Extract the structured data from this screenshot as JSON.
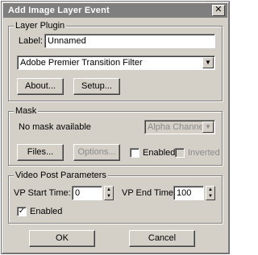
{
  "window": {
    "title": "Add Image Layer Event",
    "close_glyph": "✕"
  },
  "layer_plugin": {
    "group_label": "Layer Plugin",
    "label_caption": "Label:",
    "label_value": "Unnamed",
    "filter_selected": "Adobe Premier Transition Filter",
    "about_label": "About...",
    "setup_label": "Setup..."
  },
  "mask": {
    "group_label": "Mask",
    "no_mask_text": "No mask available",
    "channel_selected": "Alpha Channel",
    "files_label": "Files...",
    "options_label": "Options...",
    "enabled_label": "Enabled",
    "enabled_checked": false,
    "inverted_label": "Inverted",
    "inverted_checked": false
  },
  "video_post": {
    "group_label": "Video Post Parameters",
    "start_label": "VP Start Time:",
    "start_value": "0",
    "end_label": "VP End Time:",
    "end_value": "100",
    "enabled_label": "Enabled",
    "enabled_checked": true
  },
  "footer": {
    "ok_label": "OK",
    "cancel_label": "Cancel"
  },
  "icons": {
    "dropdown_arrow": "▼",
    "spin_up": "▲",
    "spin_down": "▼",
    "check_mark": "✓"
  }
}
